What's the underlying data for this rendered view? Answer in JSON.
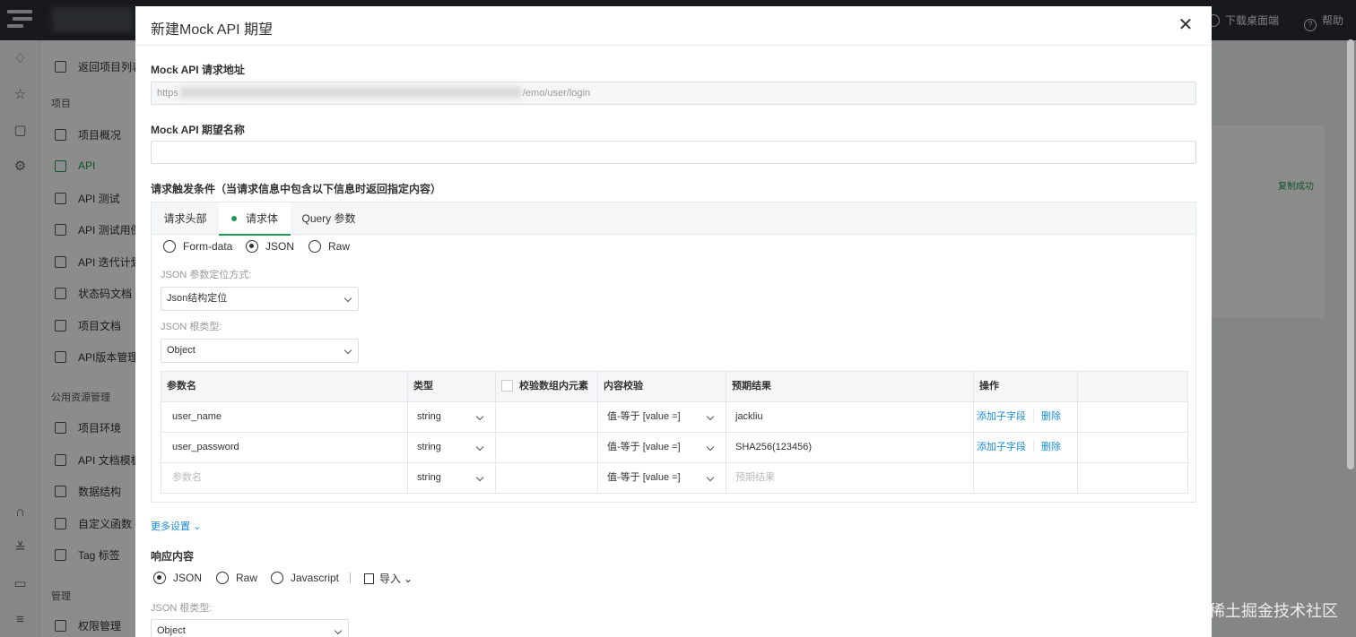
{
  "topbar": {
    "download_label": "下载桌面端",
    "help_label": "帮助"
  },
  "sidebar": {
    "back_label": "返回项目列表",
    "group_project": "项目",
    "items": [
      {
        "label": "项目概况"
      },
      {
        "label": "API"
      },
      {
        "label": "API 测试"
      },
      {
        "label": "API 测试用例"
      },
      {
        "label": "API 迭代计划"
      },
      {
        "label": "状态码文档"
      },
      {
        "label": "项目文档"
      },
      {
        "label": "API版本管理"
      }
    ],
    "group_public": "公用资源管理",
    "public_items": [
      {
        "label": "项目环境"
      },
      {
        "label": "API 文档模板"
      },
      {
        "label": "数据结构"
      },
      {
        "label": "自定义函数"
      },
      {
        "label": "Tag 标签"
      }
    ],
    "group_manage": "管理",
    "manage_items": [
      {
        "label": "权限管理"
      }
    ]
  },
  "behind": {
    "copied_text": "复制成功"
  },
  "modal": {
    "title": "新建Mock API 期望",
    "url_label": "Mock API 请求地址",
    "url_prefix": "https",
    "url_suffix": "/emo/user/login",
    "name_label": "Mock API 期望名称",
    "name_value": "",
    "trigger_label": "请求触发条件（当请求信息中包含以下信息时返回指定内容）",
    "tabs": [
      {
        "label": "请求头部"
      },
      {
        "label": "请求体"
      },
      {
        "label": "Query 参数"
      }
    ],
    "body_formats": [
      {
        "label": "Form-data"
      },
      {
        "label": "JSON"
      },
      {
        "label": "Raw"
      }
    ],
    "json_locate_label": "JSON 参数定位方式:",
    "json_locate_value": "Json结构定位",
    "json_root_label": "JSON 根类型:",
    "json_root_value": "Object",
    "table": {
      "headers": {
        "name": "参数名",
        "type": "类型",
        "verify_array": "校验数组内元素",
        "content_check": "内容校验",
        "expected": "预期结果",
        "actions": "操作"
      },
      "rows": [
        {
          "name": "user_name",
          "type": "string",
          "check": "值-等于 [value =]",
          "expected": "jackliu",
          "add": "添加子字段",
          "delete": "删除"
        },
        {
          "name": "user_password",
          "type": "string",
          "check": "值-等于 [value =]",
          "expected": "SHA256(123456)",
          "add": "添加子字段",
          "delete": "删除"
        }
      ],
      "new_row": {
        "name_placeholder": "参数名",
        "type": "string",
        "check": "值-等于 [value =]",
        "expected_placeholder": "预期结果"
      }
    },
    "more_settings": "更多设置",
    "response_label": "响应内容",
    "response_formats": [
      {
        "label": "JSON"
      },
      {
        "label": "Raw"
      },
      {
        "label": "Javascript"
      }
    ],
    "import_label": "导入",
    "resp_root_label": "JSON 根类型:",
    "resp_root_value": "Object"
  },
  "watermark": "@稀土掘金技术社区",
  "colors": {
    "accent": "#1f9a52",
    "link": "#1a8cd8",
    "topbar": "#2b2f33"
  }
}
